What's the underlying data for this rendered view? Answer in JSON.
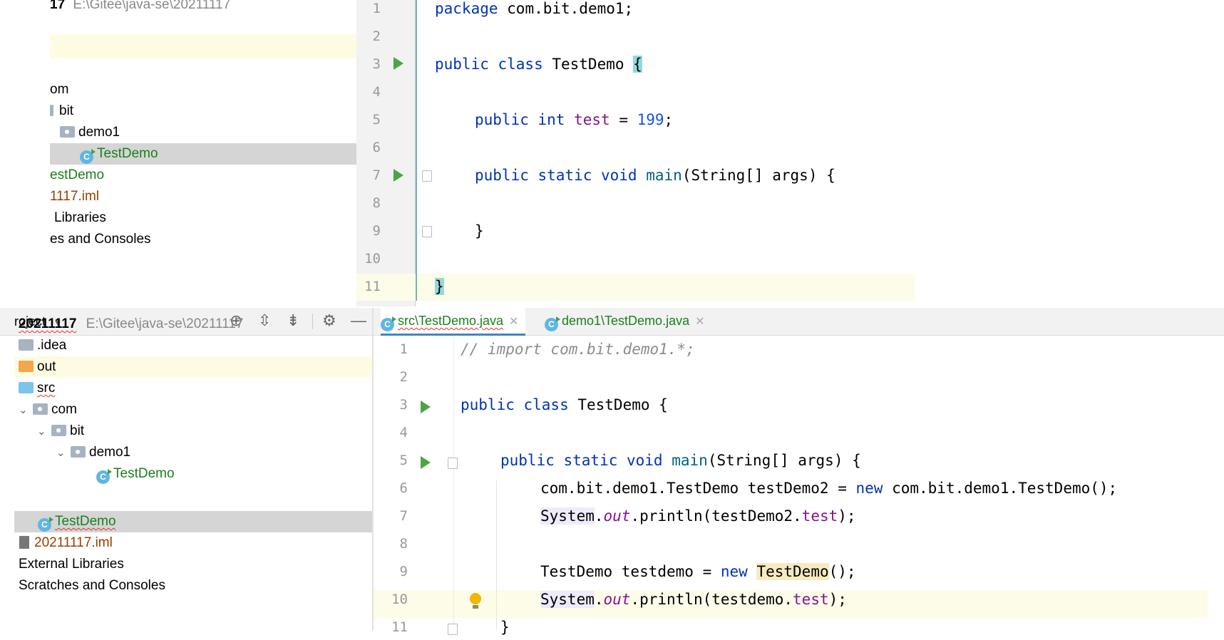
{
  "top_panel": {
    "tree": {
      "root_number": "17",
      "root_path": "E:\\Gitee\\java-se\\20211117",
      "items": [
        "om",
        "bit",
        "demo1",
        "TestDemo",
        "estDemo",
        "1117.iml",
        "Libraries",
        "es and Consoles"
      ]
    },
    "editor": {
      "line_numbers": [
        "1",
        "2",
        "3",
        "4",
        "5",
        "6",
        "7",
        "8",
        "9",
        "10",
        "11"
      ],
      "lines": {
        "l1": {
          "a": "package",
          "b": " com.bit.demo1;"
        },
        "l3": {
          "a": "public class",
          "b": " TestDemo ",
          "c": "{"
        },
        "l5": {
          "a": "public int",
          "b": "test",
          "c": " = ",
          "d": "199",
          "e": ";"
        },
        "l7": {
          "a": "public static void",
          "b": " ",
          "c": "main",
          "d": "(String[] args) {"
        },
        "l9": {
          "a": "}"
        },
        "l11": {
          "a": "}"
        }
      }
    }
  },
  "bottom_panel": {
    "toolbar": {
      "project_label": "roject",
      "dropdown_icon": "triangle-down-icon",
      "icons": [
        "locate-icon",
        "expand-all-icon",
        "collapse-all-icon",
        "gear-icon",
        "minimize-icon"
      ]
    },
    "tree": {
      "root_name": "20211117",
      "root_path": "E:\\Gitee\\java-se\\20211117",
      "items": {
        "idea": ".idea",
        "out": "out",
        "src": "src",
        "com": "com",
        "bit": "bit",
        "demo1": "demo1",
        "testdemo_inner": "TestDemo",
        "testdemo_src": "TestDemo",
        "iml": "20211117.iml",
        "ext_libs": "External Libraries",
        "scratches": "Scratches and Consoles"
      }
    },
    "tabs": [
      {
        "label": "src\\TestDemo.java",
        "active": true
      },
      {
        "label": "demo1\\TestDemo.java",
        "active": false
      }
    ],
    "editor": {
      "line_numbers": [
        "1",
        "2",
        "3",
        "4",
        "5",
        "6",
        "7",
        "8",
        "9",
        "10",
        "11"
      ],
      "lines": {
        "l1": {
          "a": "// import com.bit.demo1.*;"
        },
        "l3": {
          "a": "public class",
          "b": " TestDemo {"
        },
        "l5": {
          "a": "public static void",
          "b": " ",
          "c": "main",
          "d": "(String[] args) {"
        },
        "l6": {
          "a": "com.bit.demo1.TestDemo testDemo2 = ",
          "b": "new",
          "c": " com.bit.demo1.TestDemo();"
        },
        "l7": {
          "a": "System",
          "b": ".",
          "c": "out",
          "d": ".println(testDemo2.",
          "e": "test",
          "f": ");"
        },
        "l9": {
          "a": "TestDemo testdemo = ",
          "b": "new",
          "c": " ",
          "d": "TestDemo",
          "e": "();"
        },
        "l10": {
          "a": "System",
          "b": ".",
          "c": "out",
          "d": ".println(testdemo.",
          "e": "test",
          "f": ");"
        },
        "l11": {
          "a": "}"
        }
      }
    }
  }
}
